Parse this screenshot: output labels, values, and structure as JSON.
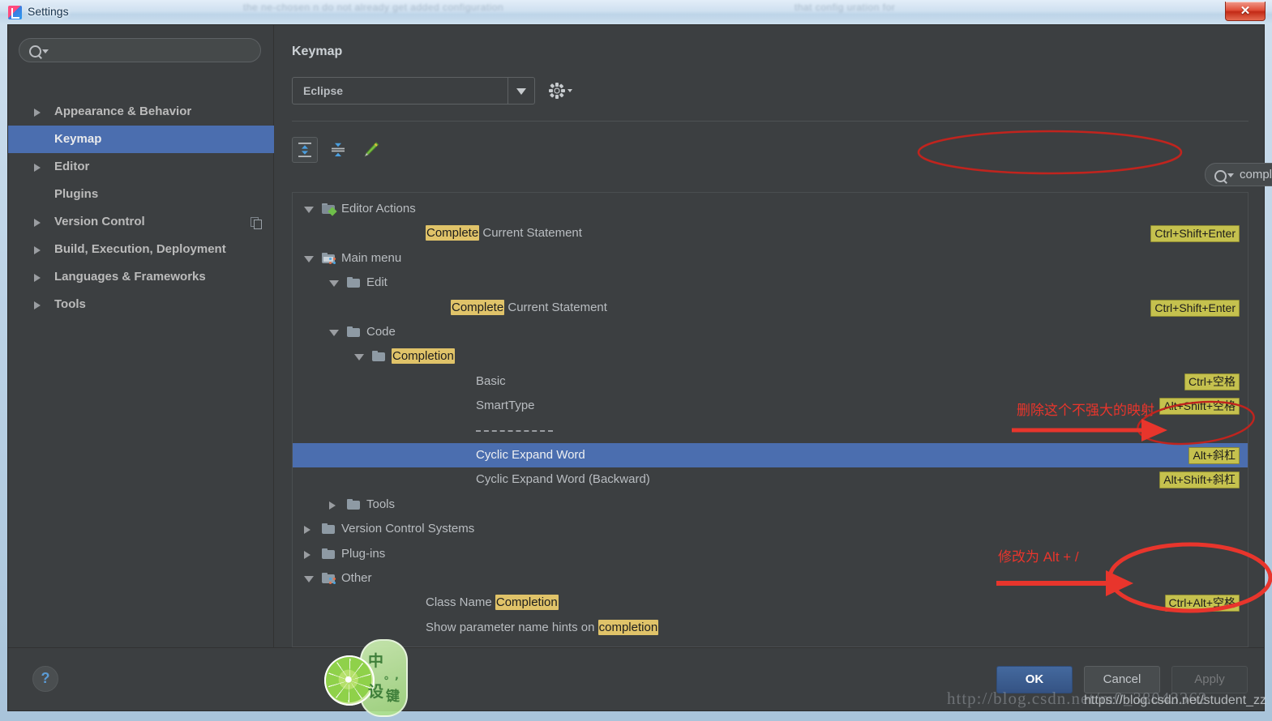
{
  "window": {
    "title": "Settings",
    "app_icon": "intellij-idea-icon",
    "close_label": "✕",
    "ghost_text_left": "the  ne-chosen  n  do  not  already  get  added  configuration",
    "ghost_text_right": "that  config  uration  for"
  },
  "sidebar": {
    "search": {
      "placeholder": "",
      "value": "",
      "icon": "search-icon"
    },
    "items": [
      {
        "label": "Appearance & Behavior",
        "expandable": true,
        "selected": false,
        "badge": null
      },
      {
        "label": "Keymap",
        "expandable": false,
        "selected": true,
        "badge": null
      },
      {
        "label": "Editor",
        "expandable": true,
        "selected": false,
        "badge": null
      },
      {
        "label": "Plugins",
        "expandable": false,
        "selected": false,
        "badge": null
      },
      {
        "label": "Version Control",
        "expandable": true,
        "selected": false,
        "badge": "copy-icon"
      },
      {
        "label": "Build, Execution, Deployment",
        "expandable": true,
        "selected": false,
        "badge": null
      },
      {
        "label": "Languages & Frameworks",
        "expandable": true,
        "selected": false,
        "badge": null
      },
      {
        "label": "Tools",
        "expandable": true,
        "selected": false,
        "badge": null
      }
    ]
  },
  "pane": {
    "title": "Keymap",
    "keymap_select": {
      "value": "Eclipse"
    },
    "gear_tooltip": "keymap-settings",
    "toolbar": {
      "expand_all": "expand-all-icon",
      "collapse_all": "collapse-all-icon",
      "edit_shortcut": "edit-pencil-icon"
    },
    "filter": {
      "value": "completion",
      "clear_label": "✕",
      "find_by_shortcut": "find-by-shortcut-icon"
    }
  },
  "tree": {
    "rows": [
      {
        "indent": 0,
        "arrow": "expanded",
        "icon": "editor-actions-icon",
        "parts": [
          {
            "t": "Editor Actions",
            "hl": false
          }
        ],
        "shortcut": null,
        "selected": false
      },
      {
        "indent": 2,
        "arrow": null,
        "icon": null,
        "parts": [
          {
            "t": "Complete",
            "hl": true
          },
          {
            "t": " Current Statement",
            "hl": false
          }
        ],
        "shortcut": "Ctrl+Shift+Enter",
        "selected": false
      },
      {
        "indent": 0,
        "arrow": "expanded",
        "icon": "main-menu-icon",
        "parts": [
          {
            "t": "Main menu",
            "hl": false
          }
        ],
        "shortcut": null,
        "selected": false
      },
      {
        "indent": 1,
        "arrow": "expanded",
        "icon": "folder-icon",
        "parts": [
          {
            "t": "Edit",
            "hl": false
          }
        ],
        "shortcut": null,
        "selected": false
      },
      {
        "indent": 3,
        "arrow": null,
        "icon": null,
        "parts": [
          {
            "t": "Complete",
            "hl": true
          },
          {
            "t": " Current Statement",
            "hl": false
          }
        ],
        "shortcut": "Ctrl+Shift+Enter",
        "selected": false
      },
      {
        "indent": 1,
        "arrow": "expanded",
        "icon": "folder-icon",
        "parts": [
          {
            "t": "Code",
            "hl": false
          }
        ],
        "shortcut": null,
        "selected": false
      },
      {
        "indent": 2,
        "arrow": "expanded",
        "icon": "folder-icon",
        "parts": [
          {
            "t": "Completion",
            "hl": true
          }
        ],
        "shortcut": null,
        "selected": false
      },
      {
        "indent": 4,
        "arrow": null,
        "icon": null,
        "parts": [
          {
            "t": "Basic",
            "hl": false
          }
        ],
        "shortcut": "Ctrl+空格",
        "selected": false
      },
      {
        "indent": 4,
        "arrow": null,
        "icon": null,
        "parts": [
          {
            "t": "SmartType",
            "hl": false
          }
        ],
        "shortcut": "Alt+Shift+空格",
        "selected": false
      },
      {
        "indent": 4,
        "arrow": null,
        "icon": null,
        "parts": [
          {
            "t": "separator",
            "hl": false
          }
        ],
        "shortcut": null,
        "selected": false,
        "separator": true
      },
      {
        "indent": 4,
        "arrow": null,
        "icon": null,
        "parts": [
          {
            "t": "Cyclic Expand Word",
            "hl": false
          }
        ],
        "shortcut": "Alt+斜杠",
        "selected": true
      },
      {
        "indent": 4,
        "arrow": null,
        "icon": null,
        "parts": [
          {
            "t": "Cyclic Expand Word (Backward)",
            "hl": false
          }
        ],
        "shortcut": "Alt+Shift+斜杠",
        "selected": false
      },
      {
        "indent": 1,
        "arrow": "collapsed",
        "icon": "folder-icon",
        "parts": [
          {
            "t": "Tools",
            "hl": false
          }
        ],
        "shortcut": null,
        "selected": false
      },
      {
        "indent": 0,
        "arrow": "collapsed",
        "icon": "folder-icon",
        "parts": [
          {
            "t": "Version Control Systems",
            "hl": false
          }
        ],
        "shortcut": null,
        "selected": false
      },
      {
        "indent": 0,
        "arrow": "collapsed",
        "icon": "folder-icon",
        "parts": [
          {
            "t": "Plug-ins",
            "hl": false
          }
        ],
        "shortcut": null,
        "selected": false
      },
      {
        "indent": 0,
        "arrow": "expanded",
        "icon": "other-icon",
        "parts": [
          {
            "t": "Other",
            "hl": false
          }
        ],
        "shortcut": null,
        "selected": false
      },
      {
        "indent": 2,
        "arrow": null,
        "icon": null,
        "parts": [
          {
            "t": "Class Name ",
            "hl": false
          },
          {
            "t": "Completion",
            "hl": true
          }
        ],
        "shortcut": "Ctrl+Alt+空格",
        "selected": false
      },
      {
        "indent": 2,
        "arrow": null,
        "icon": null,
        "parts": [
          {
            "t": "Show parameter name hints on ",
            "hl": false
          },
          {
            "t": "completion",
            "hl": true
          }
        ],
        "shortcut": null,
        "selected": false
      }
    ]
  },
  "footer": {
    "help_label": "?",
    "ok_label": "OK",
    "cancel_label": "Cancel",
    "apply_label": "Apply"
  },
  "annotations": {
    "note_delete_mapping": "删除这个不强大的映射",
    "note_change_to": "修改为 Alt + /",
    "color": "#e8352c"
  },
  "watermarks": {
    "blog_url_serif": "http://blog.csdn.net/m0_38043362",
    "blog_url_sans": "https://blog.csdn.net/student_zz"
  },
  "ime_widget": {
    "char_1": "中",
    "char_2": "设",
    "char_3": "键",
    "dot": "。,"
  }
}
